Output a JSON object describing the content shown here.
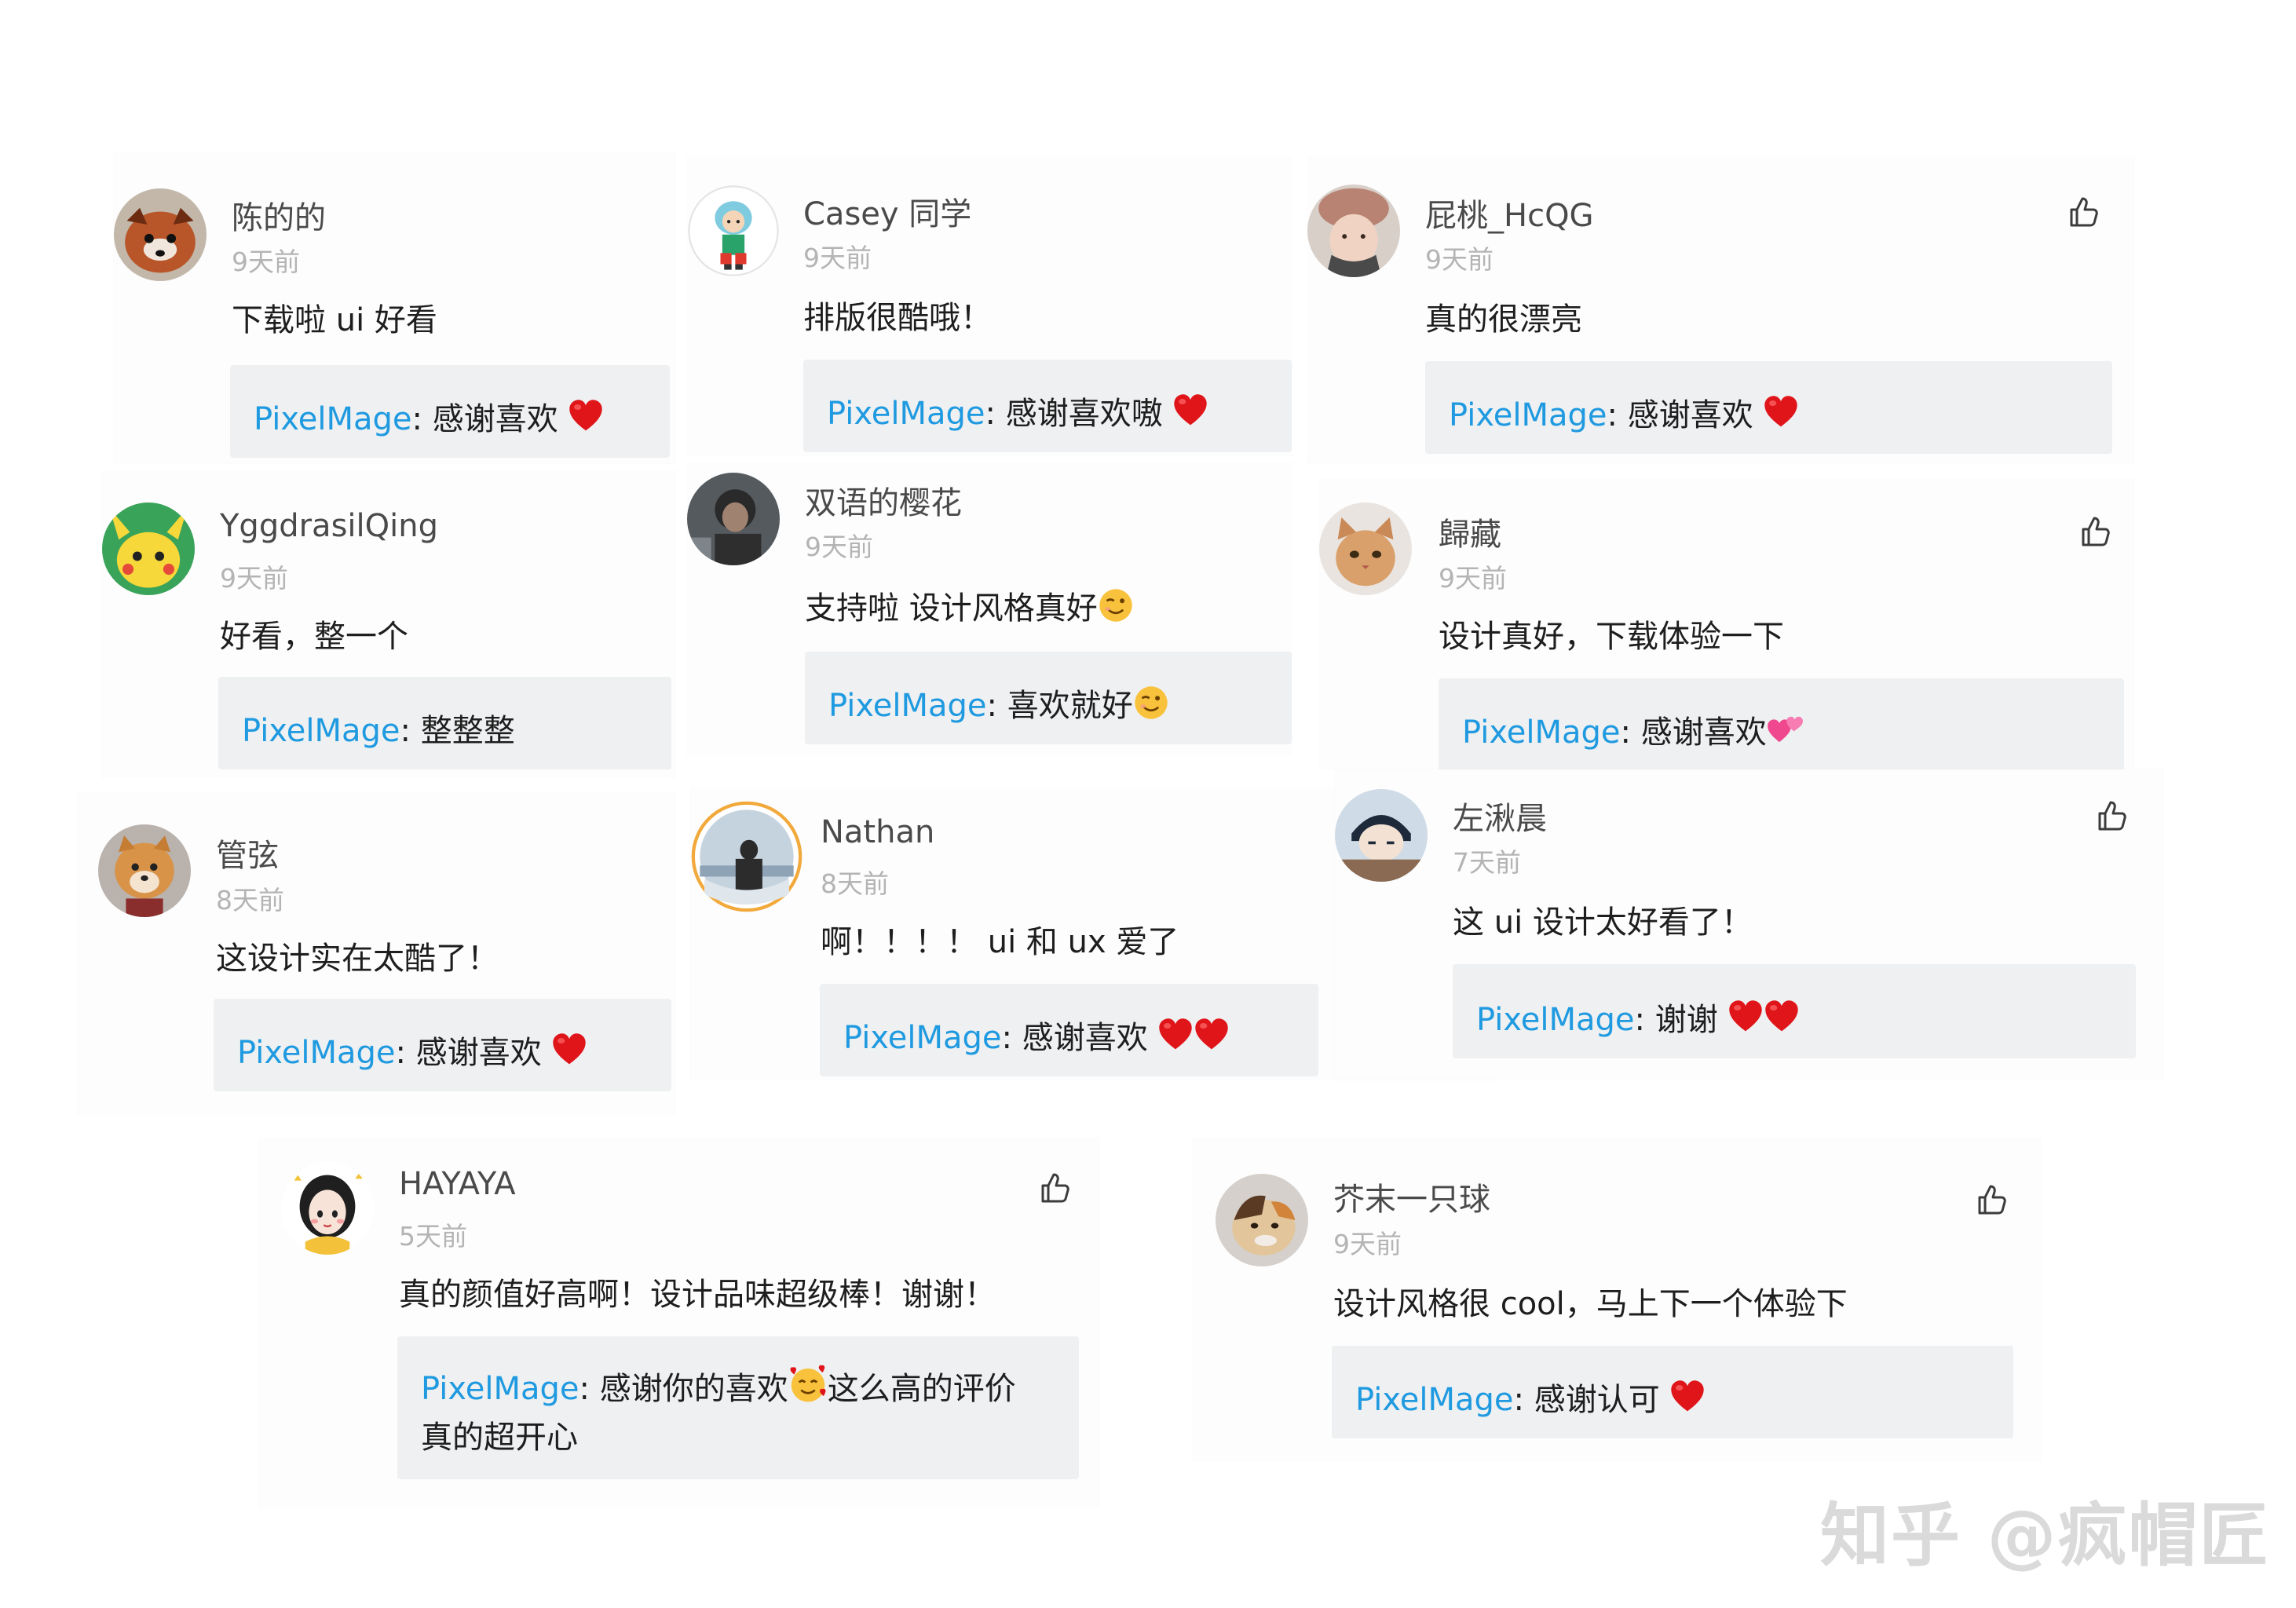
{
  "reply_author": "PixelMage",
  "reply_sep": ":",
  "comments": [
    {
      "user": "陈的的",
      "time": "9天前",
      "text": "下载啦 ui 好看",
      "reply": "感谢喜欢",
      "reply_emoji": [
        "heart"
      ]
    },
    {
      "user": "Casey 同学",
      "time": "9天前",
      "text": "排版很酷哦！",
      "reply": "感谢喜欢嗷",
      "reply_emoji": [
        "heart"
      ]
    },
    {
      "user": "屁桃_HcQG",
      "time": "9天前",
      "text": "真的很漂亮",
      "reply": "感谢喜欢",
      "reply_emoji": [
        "heart"
      ]
    },
    {
      "user": "YggdrasilQing",
      "time": "9天前",
      "text": "好看，整一个",
      "reply": "整整整",
      "reply_emoji": []
    },
    {
      "user": "双语的樱花",
      "time": "9天前",
      "text": "支持啦 设计风格真好",
      "text_emoji": [
        "wink"
      ],
      "reply": "喜欢就好",
      "reply_emoji": [
        "wink"
      ]
    },
    {
      "user": "歸藏",
      "time": "9天前",
      "text": "设计真好，下载体验一下",
      "reply": "感谢喜欢",
      "reply_emoji": [
        "two-hearts"
      ]
    },
    {
      "user": "管弦",
      "time": "8天前",
      "text": "这设计实在太酷了！",
      "reply": "感谢喜欢",
      "reply_emoji": [
        "heart"
      ]
    },
    {
      "user": "Nathan",
      "time": "8天前",
      "text": "啊！！！！ ui 和 ux 爱了",
      "reply": "感谢喜欢",
      "reply_emoji": [
        "heart",
        "heart"
      ]
    },
    {
      "user": "左湫晨",
      "time": "7天前",
      "text": "这 ui 设计太好看了！",
      "reply": "谢谢",
      "reply_emoji": [
        "heart",
        "heart"
      ]
    },
    {
      "user": "HAYAYA",
      "time": "5天前",
      "text": "真的颜值好高啊！设计品味超级棒！谢谢！",
      "reply": "感谢你的喜欢",
      "reply_mid_emoji": "smiling-hearts",
      "reply_cont": "这么高的评价",
      "reply_line2": "真的超开心"
    },
    {
      "user": "芥末一只球",
      "time": "9天前",
      "text": "设计风格很 cool，马上下一个体验下",
      "reply": "感谢认可",
      "reply_emoji": [
        "heart"
      ]
    }
  ],
  "watermark": "知乎 @疯帽匠",
  "colors": {
    "author": "#1f9ae0",
    "reply_bg": "#eef0f2",
    "time": "#b4b4b4",
    "name": "#4a4a4a"
  }
}
